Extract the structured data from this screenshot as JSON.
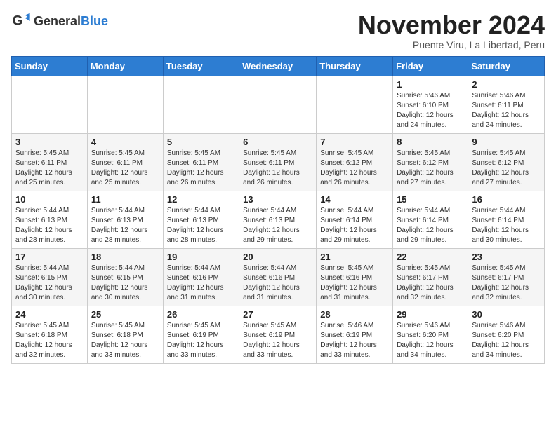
{
  "logo": {
    "general": "General",
    "blue": "Blue"
  },
  "title": "November 2024",
  "subtitle": "Puente Viru, La Libertad, Peru",
  "weekdays": [
    "Sunday",
    "Monday",
    "Tuesday",
    "Wednesday",
    "Thursday",
    "Friday",
    "Saturday"
  ],
  "weeks": [
    [
      {
        "day": "",
        "info": ""
      },
      {
        "day": "",
        "info": ""
      },
      {
        "day": "",
        "info": ""
      },
      {
        "day": "",
        "info": ""
      },
      {
        "day": "",
        "info": ""
      },
      {
        "day": "1",
        "info": "Sunrise: 5:46 AM\nSunset: 6:10 PM\nDaylight: 12 hours and 24 minutes."
      },
      {
        "day": "2",
        "info": "Sunrise: 5:46 AM\nSunset: 6:11 PM\nDaylight: 12 hours and 24 minutes."
      }
    ],
    [
      {
        "day": "3",
        "info": "Sunrise: 5:45 AM\nSunset: 6:11 PM\nDaylight: 12 hours and 25 minutes."
      },
      {
        "day": "4",
        "info": "Sunrise: 5:45 AM\nSunset: 6:11 PM\nDaylight: 12 hours and 25 minutes."
      },
      {
        "day": "5",
        "info": "Sunrise: 5:45 AM\nSunset: 6:11 PM\nDaylight: 12 hours and 26 minutes."
      },
      {
        "day": "6",
        "info": "Sunrise: 5:45 AM\nSunset: 6:11 PM\nDaylight: 12 hours and 26 minutes."
      },
      {
        "day": "7",
        "info": "Sunrise: 5:45 AM\nSunset: 6:12 PM\nDaylight: 12 hours and 26 minutes."
      },
      {
        "day": "8",
        "info": "Sunrise: 5:45 AM\nSunset: 6:12 PM\nDaylight: 12 hours and 27 minutes."
      },
      {
        "day": "9",
        "info": "Sunrise: 5:45 AM\nSunset: 6:12 PM\nDaylight: 12 hours and 27 minutes."
      }
    ],
    [
      {
        "day": "10",
        "info": "Sunrise: 5:44 AM\nSunset: 6:13 PM\nDaylight: 12 hours and 28 minutes."
      },
      {
        "day": "11",
        "info": "Sunrise: 5:44 AM\nSunset: 6:13 PM\nDaylight: 12 hours and 28 minutes."
      },
      {
        "day": "12",
        "info": "Sunrise: 5:44 AM\nSunset: 6:13 PM\nDaylight: 12 hours and 28 minutes."
      },
      {
        "day": "13",
        "info": "Sunrise: 5:44 AM\nSunset: 6:13 PM\nDaylight: 12 hours and 29 minutes."
      },
      {
        "day": "14",
        "info": "Sunrise: 5:44 AM\nSunset: 6:14 PM\nDaylight: 12 hours and 29 minutes."
      },
      {
        "day": "15",
        "info": "Sunrise: 5:44 AM\nSunset: 6:14 PM\nDaylight: 12 hours and 29 minutes."
      },
      {
        "day": "16",
        "info": "Sunrise: 5:44 AM\nSunset: 6:14 PM\nDaylight: 12 hours and 30 minutes."
      }
    ],
    [
      {
        "day": "17",
        "info": "Sunrise: 5:44 AM\nSunset: 6:15 PM\nDaylight: 12 hours and 30 minutes."
      },
      {
        "day": "18",
        "info": "Sunrise: 5:44 AM\nSunset: 6:15 PM\nDaylight: 12 hours and 30 minutes."
      },
      {
        "day": "19",
        "info": "Sunrise: 5:44 AM\nSunset: 6:16 PM\nDaylight: 12 hours and 31 minutes."
      },
      {
        "day": "20",
        "info": "Sunrise: 5:44 AM\nSunset: 6:16 PM\nDaylight: 12 hours and 31 minutes."
      },
      {
        "day": "21",
        "info": "Sunrise: 5:45 AM\nSunset: 6:16 PM\nDaylight: 12 hours and 31 minutes."
      },
      {
        "day": "22",
        "info": "Sunrise: 5:45 AM\nSunset: 6:17 PM\nDaylight: 12 hours and 32 minutes."
      },
      {
        "day": "23",
        "info": "Sunrise: 5:45 AM\nSunset: 6:17 PM\nDaylight: 12 hours and 32 minutes."
      }
    ],
    [
      {
        "day": "24",
        "info": "Sunrise: 5:45 AM\nSunset: 6:18 PM\nDaylight: 12 hours and 32 minutes."
      },
      {
        "day": "25",
        "info": "Sunrise: 5:45 AM\nSunset: 6:18 PM\nDaylight: 12 hours and 33 minutes."
      },
      {
        "day": "26",
        "info": "Sunrise: 5:45 AM\nSunset: 6:19 PM\nDaylight: 12 hours and 33 minutes."
      },
      {
        "day": "27",
        "info": "Sunrise: 5:45 AM\nSunset: 6:19 PM\nDaylight: 12 hours and 33 minutes."
      },
      {
        "day": "28",
        "info": "Sunrise: 5:46 AM\nSunset: 6:19 PM\nDaylight: 12 hours and 33 minutes."
      },
      {
        "day": "29",
        "info": "Sunrise: 5:46 AM\nSunset: 6:20 PM\nDaylight: 12 hours and 34 minutes."
      },
      {
        "day": "30",
        "info": "Sunrise: 5:46 AM\nSunset: 6:20 PM\nDaylight: 12 hours and 34 minutes."
      }
    ]
  ]
}
